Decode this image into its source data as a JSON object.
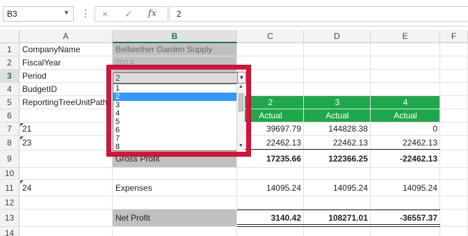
{
  "formula_bar": {
    "name_box": "B3",
    "cancel_icon": "×",
    "enter_icon": "✓",
    "fx_label": "fx",
    "formula_value": "2"
  },
  "columns": [
    "A",
    "B",
    "C",
    "D",
    "E",
    "F"
  ],
  "rows": [
    "1",
    "2",
    "3",
    "4",
    "5",
    "6",
    "7",
    "8",
    "9",
    "10",
    "11",
    "12",
    "13",
    "14"
  ],
  "cells": {
    "A1": "CompanyName",
    "B1": "Bellwether Garden Supply",
    "A2": "FiscalYear",
    "B2": "2014",
    "A3": "Period",
    "B3": "2",
    "A4": "BudgetID",
    "A5": "ReportingTreeUnitPath",
    "C5": "2",
    "D5": "3",
    "E5": "4",
    "C6": "Actual",
    "D6": "Actual",
    "E6": "Actual",
    "A7": "21",
    "C7": "39697.79",
    "D7": "144828.38",
    "E7": "0",
    "A8": "23",
    "C8": "22462.13",
    "D8": "22462.13",
    "E8": "22462.13",
    "B9": "Gross Profit",
    "C9": "17235.66",
    "D9": "122366.25",
    "E9": "-22462.13",
    "A11": "24",
    "B11": "Expenses",
    "C11": "14095.24",
    "D11": "14095.24",
    "E11": "14095.24",
    "B13": "Net Profit",
    "C13": "3140.42",
    "D13": "108271.01",
    "E13": "-36557.37"
  },
  "dropdown": {
    "options": [
      "1",
      "2",
      "3",
      "4",
      "5",
      "6",
      "7",
      "8"
    ],
    "selected": "2"
  },
  "colors": {
    "header_green": "#1fa84b",
    "label_grey": "#c0c0c0",
    "highlight_red": "#d8123a",
    "selection_blue": "#3399ff"
  }
}
